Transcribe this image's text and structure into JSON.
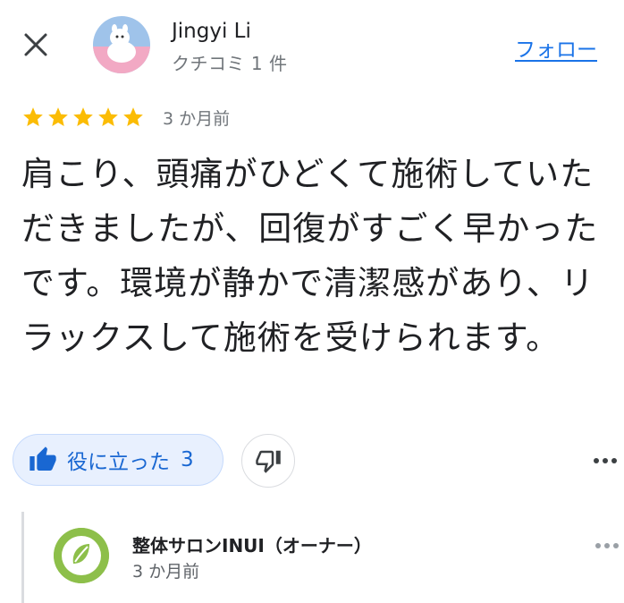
{
  "header": {
    "author_name": "Jingyi Li",
    "author_sub": "クチコミ 1 件",
    "follow_label": "フォロー"
  },
  "review": {
    "rating": 5,
    "rating_max": 5,
    "date": "3 か月前",
    "text": "肩こり、頭痛がひどくて施術していただきましたが、回復がすごく早かったです。環境が静かで清潔感があり、リラックスして施術を受けられます。"
  },
  "actions": {
    "helpful_label": "役に立った",
    "helpful_count": "3"
  },
  "owner_reply": {
    "name": "整体サロンINUI（オーナー）",
    "date": "3 か月前"
  },
  "colors": {
    "accent": "#1a73e8",
    "star": "#fbbc04",
    "helpful_bg": "#e8f0fe",
    "owner_logo": "#8dbf4a"
  }
}
